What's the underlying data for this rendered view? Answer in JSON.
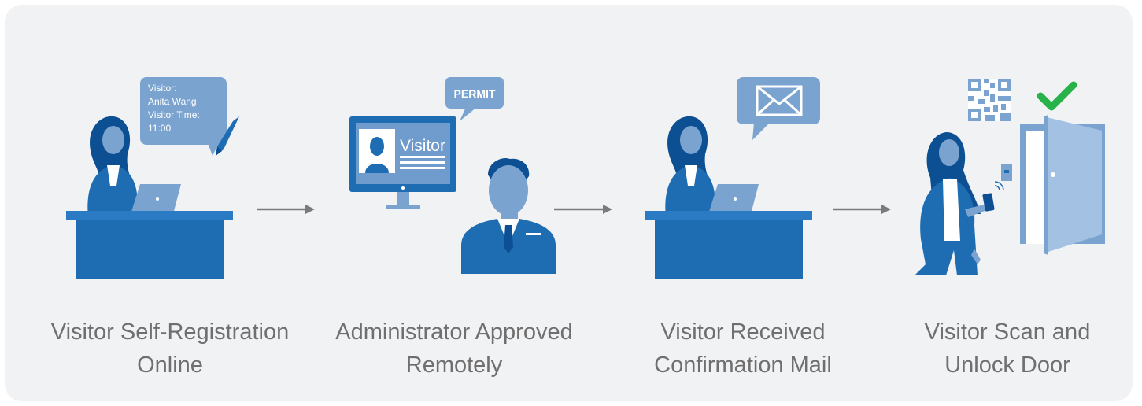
{
  "steps": [
    {
      "caption_line1": "Visitor Self-Registration",
      "caption_line2": "Online",
      "bubble": {
        "line1": "Visitor:",
        "line2": "Anita Wang",
        "line3": "Visitor Time:",
        "line4": "11:00"
      }
    },
    {
      "caption_line1": "Administrator Approved",
      "caption_line2": "Remotely",
      "bubble_label": "PERMIT",
      "screen_label": "Visitor"
    },
    {
      "caption_line1": "Visitor Received",
      "caption_line2": "Confirmation Mail"
    },
    {
      "caption_line1": "Visitor Scan and",
      "caption_line2": "Unlock Door"
    }
  ],
  "colors": {
    "primary": "#1e6db3",
    "light": "#7ba3d0",
    "dark_figure": "#0d4f93",
    "panel": "#f1f2f4",
    "caption": "#6f6f6f",
    "check": "#27b34a"
  }
}
